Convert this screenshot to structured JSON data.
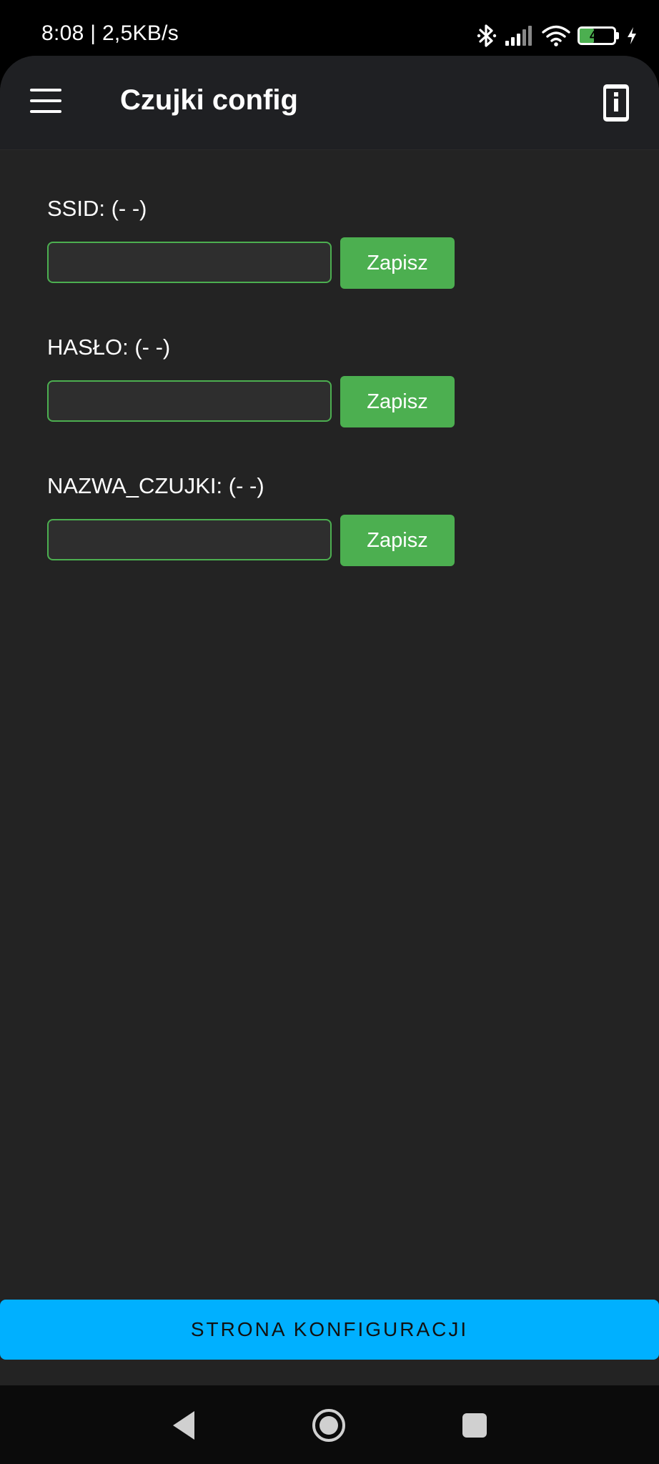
{
  "status_bar": {
    "time_speed": "8:08 | 2,5KB/s",
    "battery_level": "41",
    "battery_fraction": 0.41,
    "icons": [
      "bluetooth-icon",
      "signal-icon",
      "wifi-icon",
      "battery-icon",
      "charging-icon"
    ]
  },
  "app_bar": {
    "title": "Czujki config",
    "menu_icon": "hamburger-menu-icon",
    "info_icon": "device-info-icon"
  },
  "fields": [
    {
      "label": "SSID: (- -)",
      "value": "",
      "button": "Zapisz"
    },
    {
      "label": "HASŁO: (- -)",
      "value": "",
      "button": "Zapisz"
    },
    {
      "label": "NAZWA_CZUJKI: (- -)",
      "value": "",
      "button": "Zapisz"
    }
  ],
  "config_button": "STRONA KONFIGURACJI",
  "nav": [
    "back-icon",
    "home-icon",
    "recents-icon"
  ],
  "colors": {
    "accent_green": "#4caf50",
    "accent_blue": "#00b0ff",
    "background": "#232323",
    "app_bar": "#1f2023"
  }
}
